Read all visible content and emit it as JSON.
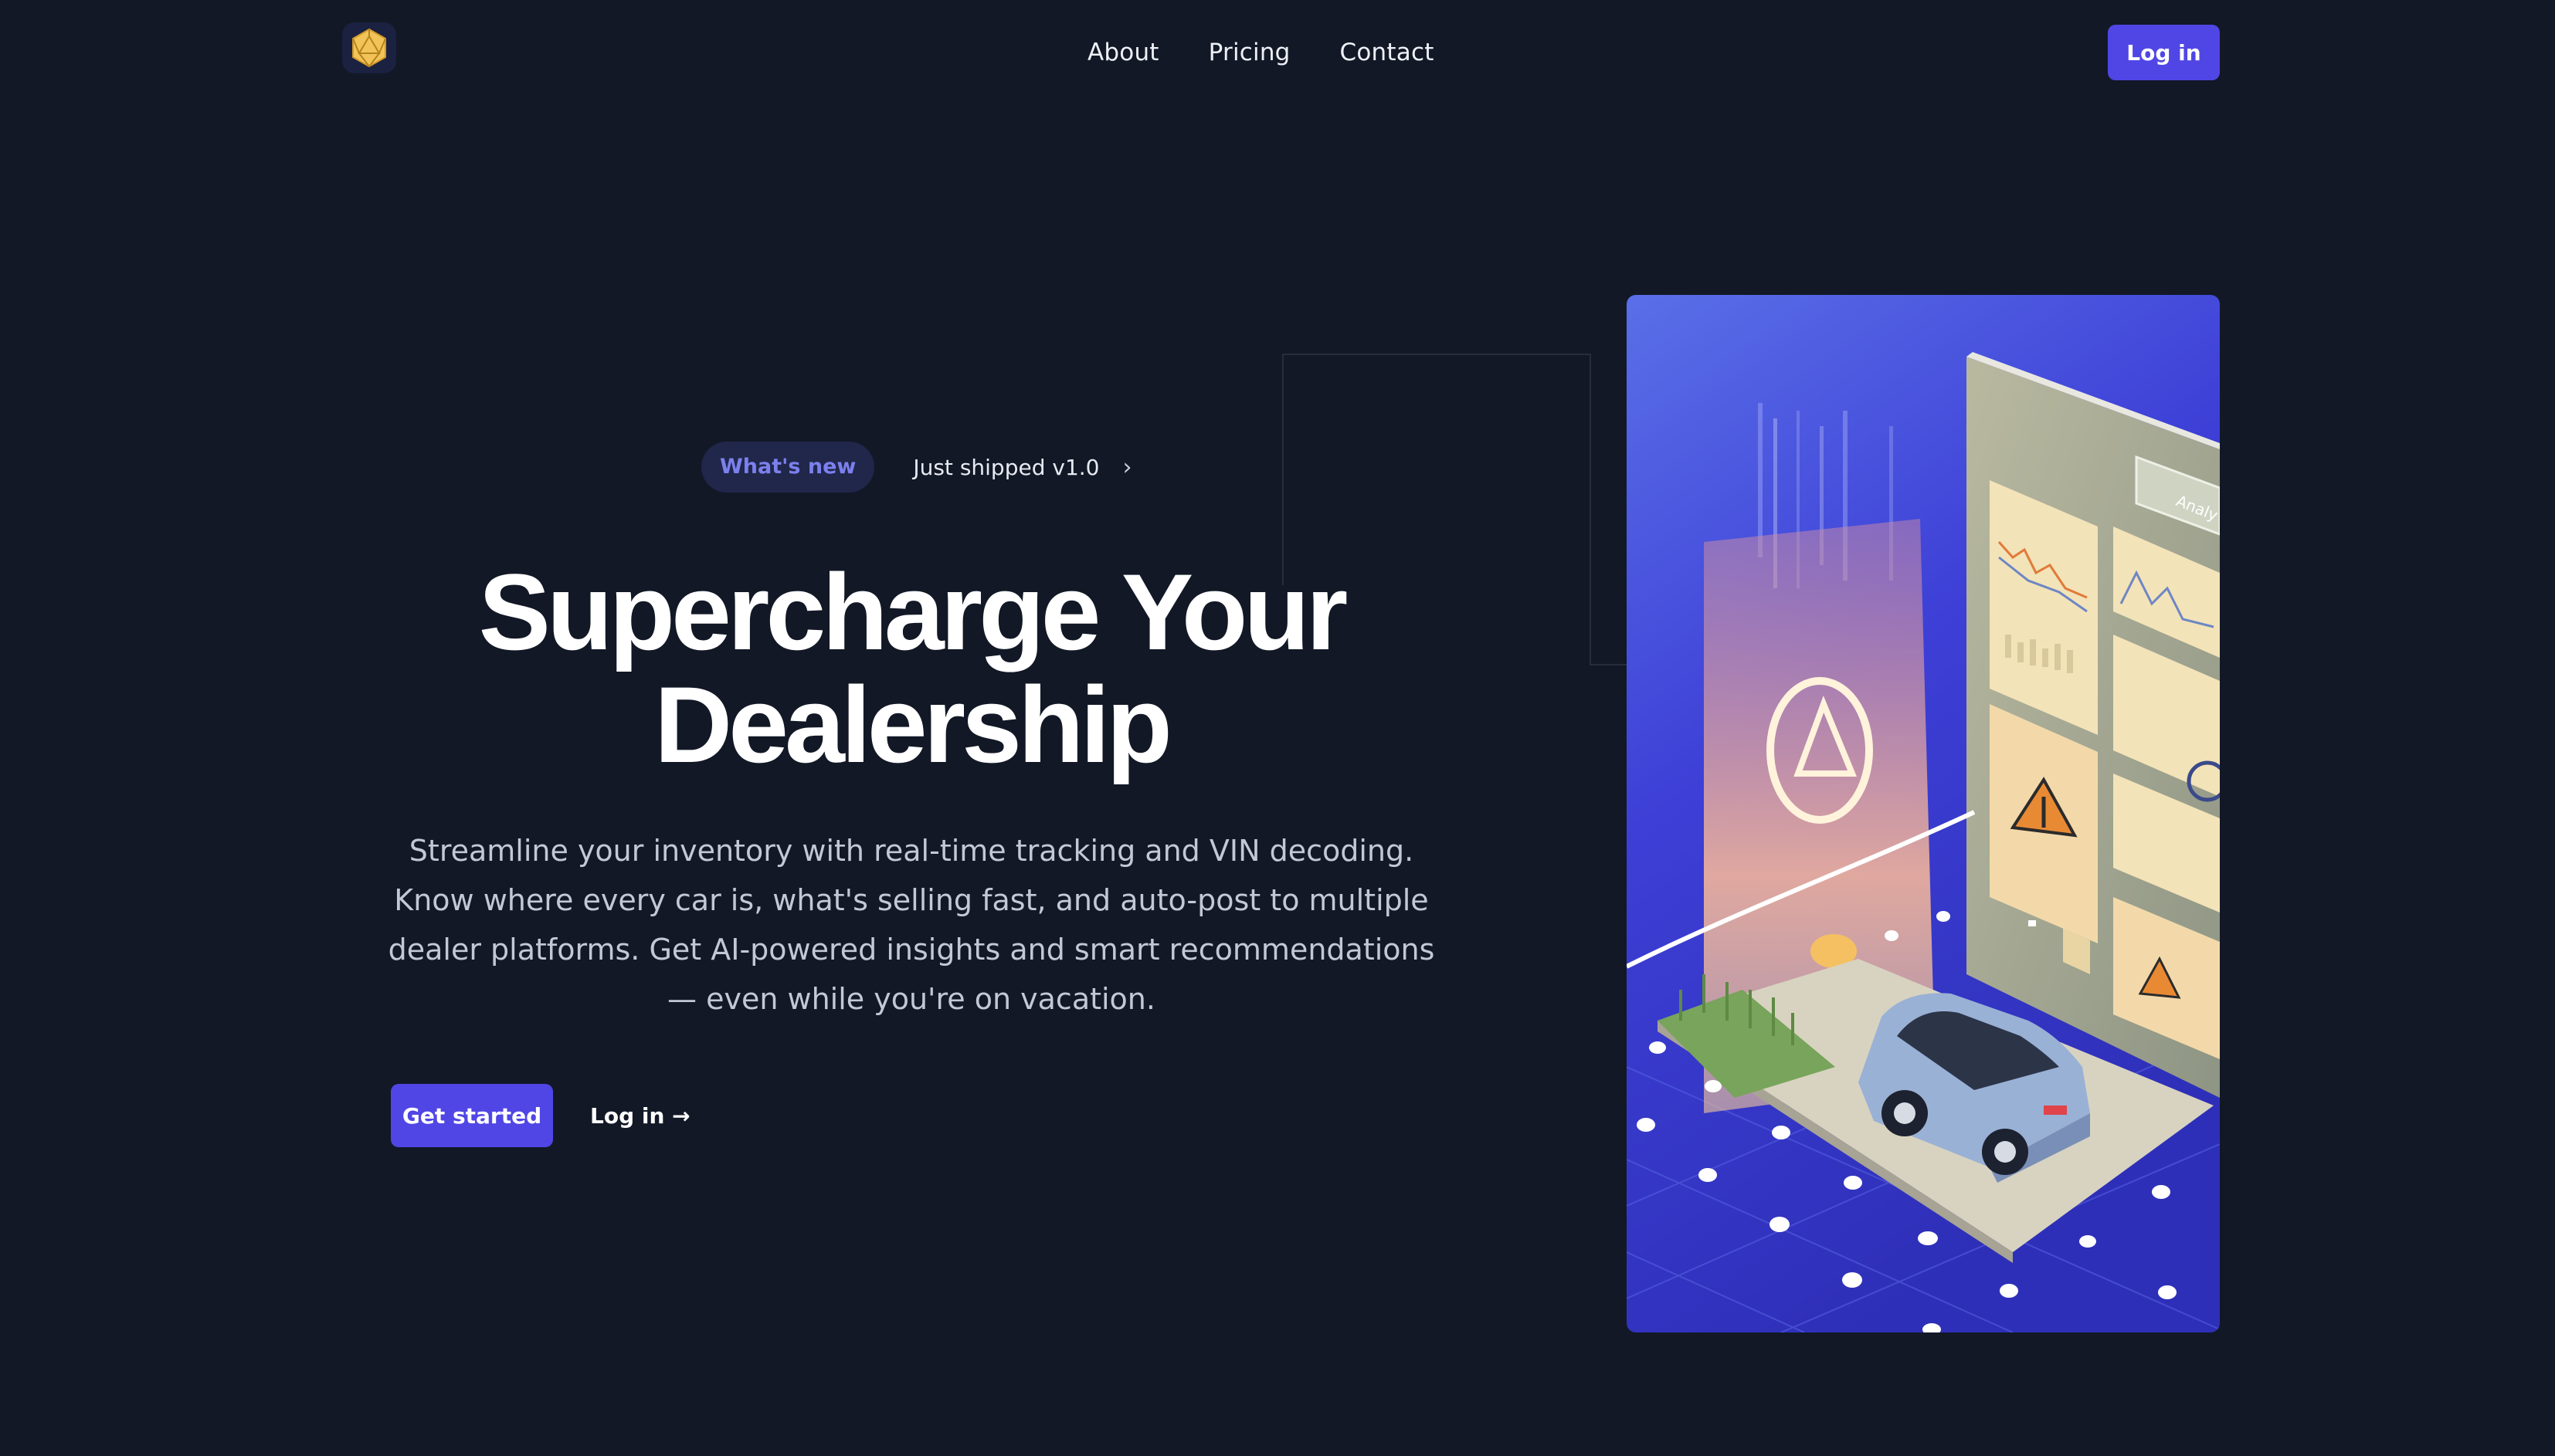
{
  "header": {
    "nav": [
      {
        "label": "About"
      },
      {
        "label": "Pricing"
      },
      {
        "label": "Contact"
      }
    ],
    "login_label": "Log in"
  },
  "hero": {
    "badge": "What's new",
    "announcement": "Just shipped v1.0",
    "headline_line1": "Supercharge Your",
    "headline_line2": "Dealership",
    "subheadline": "Streamline your inventory with real-time tracking and VIN decoding. Know where every car is, what's selling fast, and auto-post to multiple dealer platforms. Get AI-powered insights and smart recommendations — even while you're on vacation.",
    "cta_primary": "Get started",
    "cta_secondary": "Log in →"
  },
  "illustration": {
    "panel_label": "Analy"
  },
  "colors": {
    "background": "#121826",
    "accent": "#5046e5",
    "badge_text": "#7c80ee"
  },
  "icons": [
    "logo-icosahedron-icon",
    "chevron-right-icon",
    "arrow-right-icon"
  ]
}
